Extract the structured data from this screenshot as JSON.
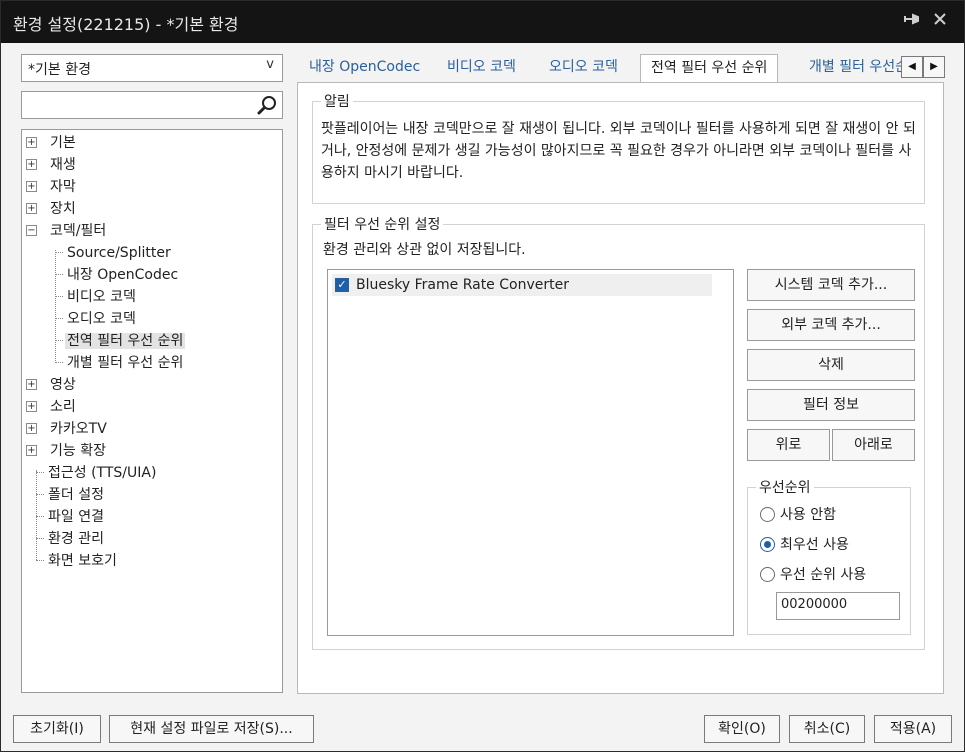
{
  "window": {
    "title": "환경 설정(221215) - *기본 환경"
  },
  "sidebar": {
    "profile": "*기본 환경",
    "profile_arrow": "v",
    "search_placeholder": "",
    "tree": [
      {
        "label": "기본",
        "expander": "+"
      },
      {
        "label": "재생",
        "expander": "+"
      },
      {
        "label": "자막",
        "expander": "+"
      },
      {
        "label": "장치",
        "expander": "+"
      },
      {
        "label": "코덱/필터",
        "expander": "−"
      },
      {
        "label": "Source/Splitter"
      },
      {
        "label": "내장 OpenCodec"
      },
      {
        "label": "비디오 코덱"
      },
      {
        "label": "오디오 코덱"
      },
      {
        "label": "전역 필터 우선 순위"
      },
      {
        "label": "개별 필터 우선 순위"
      },
      {
        "label": "영상",
        "expander": "+"
      },
      {
        "label": "소리",
        "expander": "+"
      },
      {
        "label": "카카오TV",
        "expander": "+"
      },
      {
        "label": "기능 확장",
        "expander": "+"
      },
      {
        "label": "접근성 (TTS/UIA)"
      },
      {
        "label": "폴더 설정"
      },
      {
        "label": "파일 연결"
      },
      {
        "label": "환경 관리"
      },
      {
        "label": "화면 보호기"
      }
    ]
  },
  "tabs": [
    {
      "label": "내장 OpenCodec"
    },
    {
      "label": "비디오 코덱"
    },
    {
      "label": "오디오 코덱"
    },
    {
      "label": "전역 필터 우선 순위"
    },
    {
      "label": "개별 필터 우선순위"
    }
  ],
  "tab_scroll": {
    "left": "◀",
    "right": "▶"
  },
  "notice": {
    "title": "알림",
    "text": "팟플레이어는 내장 코덱만으로 잘 재생이 됩니다. 외부 코덱이나 필터를 사용하게 되면 잘 재생이 안 되거나, 안정성에 문제가 생길 가능성이 많아지므로 꼭 필요한 경우가 아니라면 외부 코덱이나 필터를 사용하지 마시기 바랍니다."
  },
  "filter_settings": {
    "title": "필터 우선 순위 설정",
    "note": "환경 관리와 상관 없이 저장됩니다.",
    "filters": [
      {
        "label": "Bluesky Frame Rate Converter",
        "checked": true,
        "check_mark": "✓"
      }
    ],
    "buttons": {
      "add_system": "시스템 코덱 추가...",
      "add_external": "외부 코덱 추가...",
      "delete": "삭제",
      "info": "필터 정보",
      "up": "위로",
      "down": "아래로"
    },
    "priority": {
      "title": "우선순위",
      "options": [
        {
          "label": "사용 안함",
          "selected": false
        },
        {
          "label": "최우선 사용",
          "selected": true
        },
        {
          "label": "우선 순위 사용",
          "selected": false
        }
      ],
      "value": "00200000"
    }
  },
  "footer": {
    "reset": "초기화(I)",
    "save_to_file": "현재 설정 파일로 저장(S)...",
    "ok": "확인(O)",
    "cancel": "취소(C)",
    "apply": "적용(A)"
  }
}
